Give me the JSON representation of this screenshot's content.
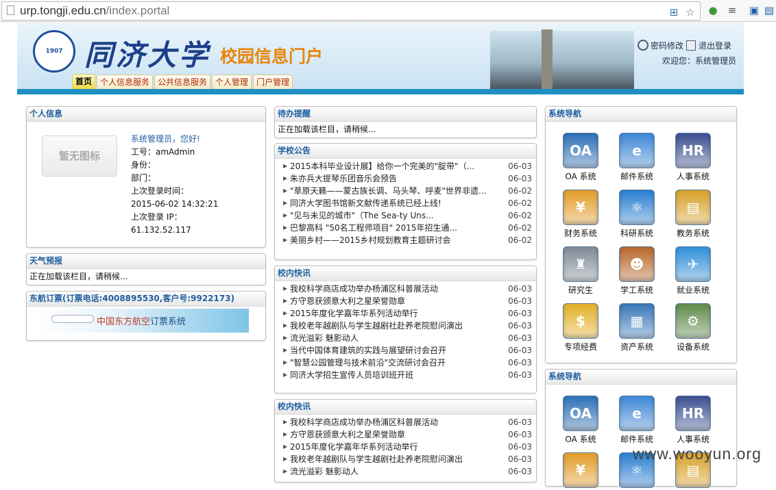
{
  "browser": {
    "url_domain": "urp.tongji.edu.cn",
    "url_path": "/index.portal"
  },
  "header": {
    "logo_name": "同济大学",
    "logo_portal": "校园信息门户",
    "password_link": "密码修改",
    "logout_link": "退出登录",
    "welcome": "欢迎您：系统管理员"
  },
  "tabs": [
    "首页",
    "个人信息服务",
    "公共信息服务",
    "个人管理",
    "门户管理"
  ],
  "personal": {
    "title": "个人信息",
    "no_image": "暂无图标",
    "greeting": "系统管理员，您好!",
    "id_line": "工号：amAdmin",
    "identity": "身份：",
    "department": "部门：",
    "last_login_label": "上次登录时间：",
    "last_login_time": "2015-06-02 14:32:21",
    "last_ip_label": "上次登录 IP：",
    "last_ip": "61.132.52.117"
  },
  "weather": {
    "title": "天气预报",
    "loading": "正在加载该栏目，请稍候..."
  },
  "airline": {
    "title": "东航订票(订票电话:4008895530,客户号:9922173)",
    "banner_red": "中国东方航空",
    "banner_blue": "订票系统"
  },
  "todo": {
    "title": "待办提醒",
    "loading": "正在加载该栏目，请稍候..."
  },
  "announcements": {
    "title": "学校公告",
    "items": [
      {
        "text": "2015本科毕业设计展】给你一个完美的\"腚带\"（...",
        "date": "06-03"
      },
      {
        "text": "朱亦兵大提琴乐团音乐会预告",
        "date": "06-03"
      },
      {
        "text": "\"草原天籁——蒙古族长调、马头琴、呼麦\"世界非遗...",
        "date": "06-02"
      },
      {
        "text": "同济大学图书馆新文献传递系统已经上线!",
        "date": "06-02"
      },
      {
        "text": "\"见与未见的城市\"（The Sea-ty Uns...",
        "date": "06-02"
      },
      {
        "text": "巴黎高科 \"50名工程师项目\" 2015年招生通...",
        "date": "06-02"
      },
      {
        "text": "美丽乡村——2015乡村规划教育主题研讨会",
        "date": "06-02"
      }
    ]
  },
  "campus_news_1": {
    "title": "校内快讯",
    "items": [
      {
        "text": "我校科学商店成功举办杨浦区科普展活动",
        "date": "06-03"
      },
      {
        "text": "方守恩获颁意大利之星荣誉勋章",
        "date": "06-03"
      },
      {
        "text": "2015年度化学嘉年华系列活动举行",
        "date": "06-03"
      },
      {
        "text": "我校老年越剧队与学生越剧社赴养老院慰问演出",
        "date": "06-03"
      },
      {
        "text": "流光溢彩 魅影动人",
        "date": "06-03"
      },
      {
        "text": "当代中国体育建筑的实践与展望研讨会召开",
        "date": "06-03"
      },
      {
        "text": "\"智慧公园管理与技术前沿\"交流研讨会召开",
        "date": "06-03"
      },
      {
        "text": "同济大学招生宣传人员培训班开班",
        "date": "06-03"
      }
    ]
  },
  "campus_news_2": {
    "title": "校内快讯",
    "items": [
      {
        "text": "我校科学商店成功举办杨浦区科普展活动",
        "date": "06-03"
      },
      {
        "text": "方守恩获颁意大利之星荣誉勋章",
        "date": "06-03"
      },
      {
        "text": "2015年度化学嘉年华系列活动举行",
        "date": "06-03"
      },
      {
        "text": "我校老年越剧队与学生越剧社赴养老院慰问演出",
        "date": "06-03"
      },
      {
        "text": "流光溢彩 魅影动人",
        "date": "06-03"
      }
    ]
  },
  "sysnav_1": {
    "title": "系统导航",
    "systems": [
      {
        "label": "OA 系统",
        "glyph": "OA",
        "color": "#2c6fb5",
        "icon": "oa-icon"
      },
      {
        "label": "邮件系统",
        "glyph": "e",
        "color": "#3d86d6",
        "icon": "mail-icon"
      },
      {
        "label": "人事系统",
        "glyph": "HR",
        "color": "#3b4f8f",
        "icon": "hr-icon"
      },
      {
        "label": "财务系统",
        "glyph": "¥",
        "color": "#e39c2a",
        "icon": "finance-icon"
      },
      {
        "label": "科研系统",
        "glyph": "⚛",
        "color": "#2a7ed0",
        "icon": "research-icon"
      },
      {
        "label": "教务系统",
        "glyph": "▤",
        "color": "#d8a12a",
        "icon": "academic-icon"
      },
      {
        "label": "研究生",
        "glyph": "♜",
        "color": "#7f8a96",
        "icon": "graduate-icon"
      },
      {
        "label": "学工系统",
        "glyph": "☻",
        "color": "#b8662a",
        "icon": "student-affairs-icon"
      },
      {
        "label": "就业系统",
        "glyph": "✈",
        "color": "#2f8fd8",
        "icon": "employment-icon"
      },
      {
        "label": "专项经费",
        "glyph": "$",
        "color": "#e3b02a",
        "icon": "special-fund-icon"
      },
      {
        "label": "资产系统",
        "glyph": "▦",
        "color": "#3a78b8",
        "icon": "asset-icon"
      },
      {
        "label": "设备系统",
        "glyph": "⚙",
        "color": "#5f8a4a",
        "icon": "equipment-icon"
      }
    ]
  },
  "sysnav_2": {
    "title": "系统导航",
    "systems": [
      {
        "label": "OA 系统",
        "glyph": "OA",
        "color": "#2c6fb5",
        "icon": "oa-icon"
      },
      {
        "label": "邮件系统",
        "glyph": "e",
        "color": "#3d86d6",
        "icon": "mail-icon"
      },
      {
        "label": "人事系统",
        "glyph": "HR",
        "color": "#3b4f8f",
        "icon": "hr-icon"
      },
      {
        "label": "",
        "glyph": "¥",
        "color": "#e39c2a",
        "icon": "finance-icon"
      },
      {
        "label": "",
        "glyph": "⚛",
        "color": "#2a7ed0",
        "icon": "research-icon"
      },
      {
        "label": "",
        "glyph": "▤",
        "color": "#d8a12a",
        "icon": "academic-icon"
      }
    ]
  },
  "watermark": "www.wooyun.org"
}
